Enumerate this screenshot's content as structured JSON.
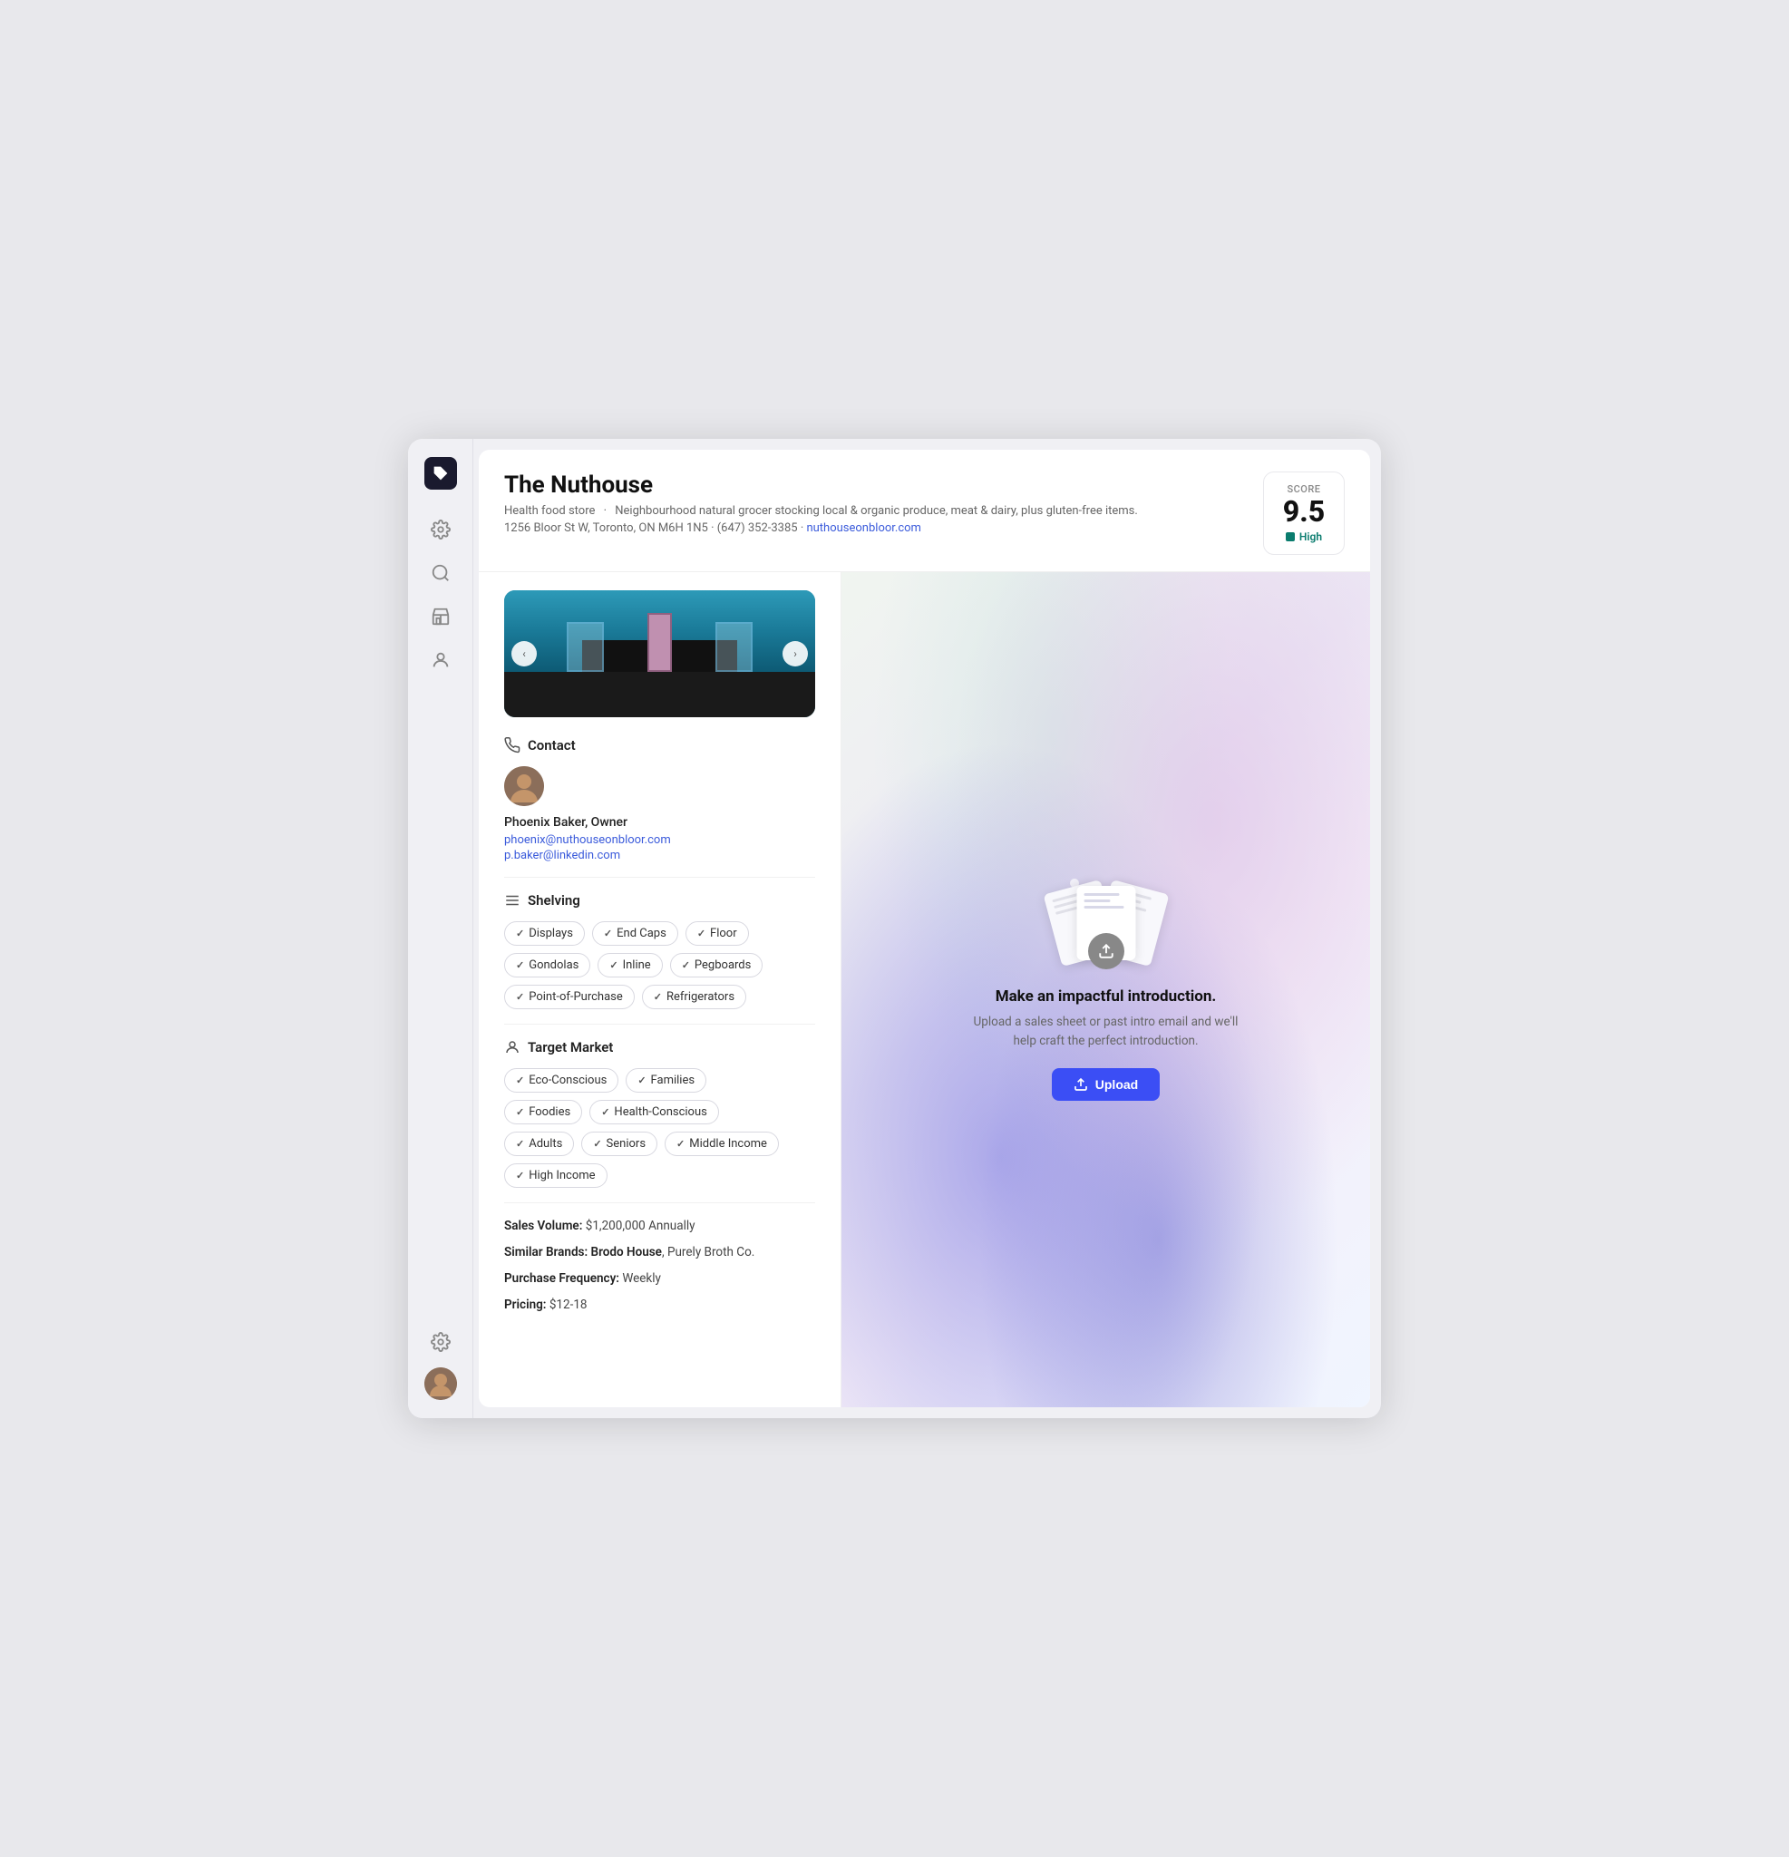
{
  "app": {
    "logo_label": "App Logo"
  },
  "sidebar": {
    "icons": [
      {
        "name": "settings-icon",
        "symbol": "⚙"
      },
      {
        "name": "search-icon",
        "symbol": "🔍"
      },
      {
        "name": "store-icon",
        "symbol": "🏪"
      },
      {
        "name": "user-icon",
        "symbol": "👤"
      }
    ],
    "bottom_settings": "⚙",
    "avatar_alt": "User Avatar"
  },
  "header": {
    "store_name": "The Nuthouse",
    "store_type": "Health food store",
    "description": "Neighbourhood natural grocer stocking local & organic produce, meat & dairy, plus gluten-free items.",
    "address": "1256 Bloor St W, Toronto, ON M6H 1N5",
    "phone": "(647) 352-3385",
    "website": "nuthouseonbloor.com",
    "score": {
      "label": "Score",
      "value": "9.5",
      "level": "High"
    }
  },
  "contact": {
    "section_title": "Contact",
    "name": "Phoenix Baker, Owner",
    "email": "phoenix@nuthouseonbloor.com",
    "linkedin": "p.baker@linkedin.com"
  },
  "shelving": {
    "section_title": "Shelving",
    "tags": [
      "Displays",
      "End Caps",
      "Floor",
      "Gondolas",
      "Inline",
      "Pegboards",
      "Point-of-Purchase",
      "Refrigerators"
    ]
  },
  "target_market": {
    "section_title": "Target Market",
    "tags": [
      "Eco-Conscious",
      "Families",
      "Foodies",
      "Health-Conscious",
      "Adults",
      "Seniors",
      "Middle Income",
      "High Income"
    ]
  },
  "details": {
    "sales_volume_label": "Sales Volume:",
    "sales_volume_value": "$1,200,000 Annually",
    "similar_brands_label": "Similar Brands:",
    "similar_brands_value1": "Brodo House",
    "similar_brands_separator": ",",
    "similar_brands_value2": "Purely Broth Co.",
    "purchase_freq_label": "Purchase Frequency:",
    "purchase_freq_value": "Weekly",
    "pricing_label": "Pricing:",
    "pricing_value": "$12-18"
  },
  "upload_panel": {
    "title": "Make an impactful introduction.",
    "description": "Upload a sales sheet or past intro email and we'll help craft the perfect introduction.",
    "button_label": "Upload"
  }
}
